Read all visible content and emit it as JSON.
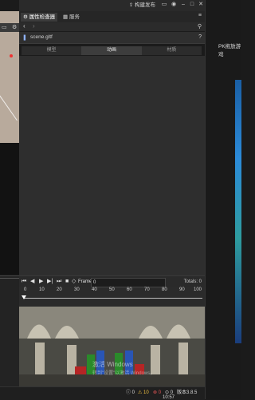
{
  "topbar": {
    "build_label": "构建发布"
  },
  "tabs": {
    "inspector": "属性检查器",
    "service": "服务"
  },
  "file": {
    "name": "scene.gltf"
  },
  "subtabs": {
    "model": "模型",
    "animation": "动画",
    "material": "材质"
  },
  "animation": {
    "frame_label": "Frame",
    "frame_value": "0",
    "totals_label": "Totals: 0",
    "ticks": [
      "0",
      "10",
      "20",
      "30",
      "40",
      "50",
      "60",
      "70",
      "80",
      "90",
      "100"
    ]
  },
  "preview": {
    "watermark_line1": "激活 Windows",
    "watermark_line2": "转到\"设置\"以激活 Windows。"
  },
  "right": {
    "label": "PK拖放游戏"
  },
  "status": {
    "info": "0",
    "warn": "10",
    "error": "0",
    "other": "0",
    "version": "版本3.8.5",
    "time": "10:57"
  },
  "colors": {
    "accent": "#3b3b3b",
    "background": "#2e2e2e"
  }
}
